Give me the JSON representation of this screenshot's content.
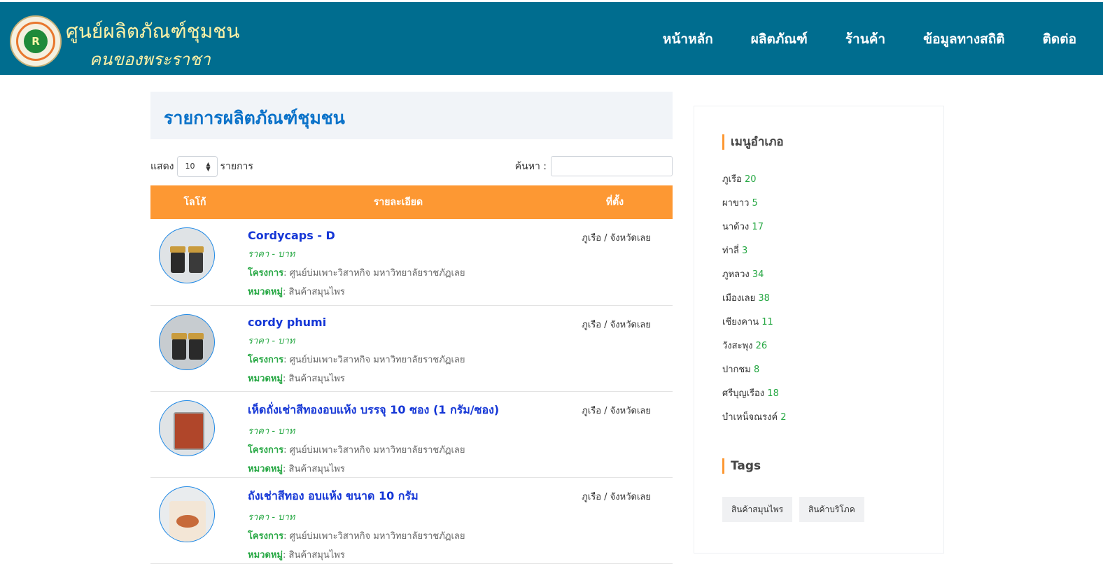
{
  "header": {
    "title": "ศูนย์ผลิตภัณฑ์ชุมชน",
    "subtitle": "คนของพระราชา",
    "nav": [
      "หน้าหลัก",
      "ผลิตภัณฑ์",
      "ร้านค้า",
      "ข้อมูลทางสถิติ",
      "ติดต่อ"
    ]
  },
  "main": {
    "heading": "รายการผลิตภัณฑ์ชุมชน",
    "show_label": "แสดง",
    "page_size": "10",
    "records_label": "รายการ",
    "search_label": "ค้นหา :",
    "columns": [
      "โลโก้",
      "รายละเอียด",
      "ที่ตั้ง"
    ],
    "products": [
      {
        "name": "Cordycaps - D",
        "price": "ราคา - บาท",
        "project_key": "โครงการ",
        "project": ": ศูนย์บ่มเพาะวิสาหกิจ มหาวิทยาลัยราชภัฏเลย",
        "category_key": "หมวดหมู่",
        "category": ": สินค้าสมุนไพร",
        "location": "ภูเรือ / จังหวัดเลย"
      },
      {
        "name": "cordy phumi",
        "price": "ราคา - บาท",
        "project_key": "โครงการ",
        "project": ": ศูนย์บ่มเพาะวิสาหกิจ มหาวิทยาลัยราชภัฏเลย",
        "category_key": "หมวดหมู่",
        "category": ": สินค้าสมุนไพร",
        "location": "ภูเรือ / จังหวัดเลย"
      },
      {
        "name": "เห็ดถั่งเช่าสีทองอบแห้ง บรรจุ 10 ซอง (1 กรัม/ซอง)",
        "price": "ราคา - บาท",
        "project_key": "โครงการ",
        "project": ": ศูนย์บ่มเพาะวิสาหกิจ มหาวิทยาลัยราชภัฏเลย",
        "category_key": "หมวดหมู่",
        "category": ": สินค้าสมุนไพร",
        "location": "ภูเรือ / จังหวัดเลย"
      },
      {
        "name": "ถังเช่าสีทอง อบแห้ง ขนาด 10 กรัม",
        "price": "ราคา - บาท",
        "project_key": "โครงการ",
        "project": ": ศูนย์บ่มเพาะวิสาหกิจ มหาวิทยาลัยราชภัฏเลย",
        "category_key": "หมวดหมู่",
        "category": ": สินค้าสมุนไพร",
        "location": "ภูเรือ / จังหวัดเลย"
      }
    ]
  },
  "sidebar": {
    "menu_title": "เมนูอำเภอ",
    "districts": [
      {
        "name": "ภูเรือ",
        "count": "20"
      },
      {
        "name": "ผาขาว",
        "count": "5"
      },
      {
        "name": "นาด้วง",
        "count": "17"
      },
      {
        "name": "ท่าลี่",
        "count": "3"
      },
      {
        "name": "ภูหลวง",
        "count": "34"
      },
      {
        "name": "เมืองเลย",
        "count": "38"
      },
      {
        "name": "เชียงคาน",
        "count": "11"
      },
      {
        "name": "วังสะพุง",
        "count": "26"
      },
      {
        "name": "ปากชม",
        "count": "8"
      },
      {
        "name": "ศรีบุญเรือง",
        "count": "18"
      },
      {
        "name": "บำเหน็จณรงค์",
        "count": "2"
      }
    ],
    "tags_title": "Tags",
    "tags": [
      "สินค้าสมุนไพร",
      "สินค้าบริโภค"
    ]
  }
}
